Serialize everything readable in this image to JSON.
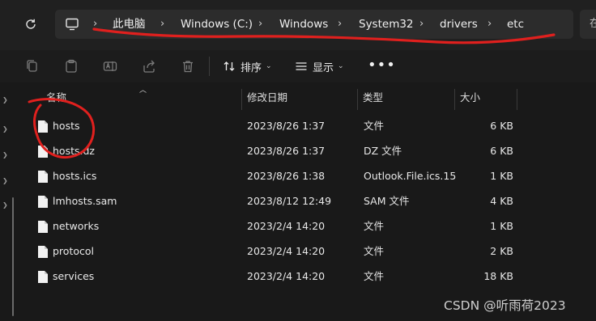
{
  "address_bar": {
    "crumbs": [
      "此电脑",
      "Windows (C:)",
      "Windows",
      "System32",
      "drivers",
      "etc"
    ],
    "separator": "›",
    "search_text": "在"
  },
  "toolbar": {
    "sort_label": "排序",
    "view_label": "显示",
    "more_label": "•••"
  },
  "columns": {
    "name": "名称",
    "modified": "修改日期",
    "type": "类型",
    "size": "大小"
  },
  "files": [
    {
      "name": "hosts",
      "modified": "2023/8/26 1:37",
      "type": "文件",
      "size": "6 KB"
    },
    {
      "name": "hosts.dz",
      "modified": "2023/8/26 1:37",
      "type": "DZ 文件",
      "size": "6 KB"
    },
    {
      "name": "hosts.ics",
      "modified": "2023/8/26 1:38",
      "type": "Outlook.File.ics.15",
      "size": "1 KB"
    },
    {
      "name": "lmhosts.sam",
      "modified": "2023/8/12 12:49",
      "type": "SAM 文件",
      "size": "4 KB"
    },
    {
      "name": "networks",
      "modified": "2023/2/4 14:20",
      "type": "文件",
      "size": "1 KB"
    },
    {
      "name": "protocol",
      "modified": "2023/2/4 14:20",
      "type": "文件",
      "size": "2 KB"
    },
    {
      "name": "services",
      "modified": "2023/2/4 14:20",
      "type": "文件",
      "size": "18 KB"
    }
  ],
  "watermark": "CSDN @听雨荷2023",
  "colors": {
    "background": "#191919",
    "address_box": "#2c2c2c",
    "annotation_red": "#e0201e"
  }
}
